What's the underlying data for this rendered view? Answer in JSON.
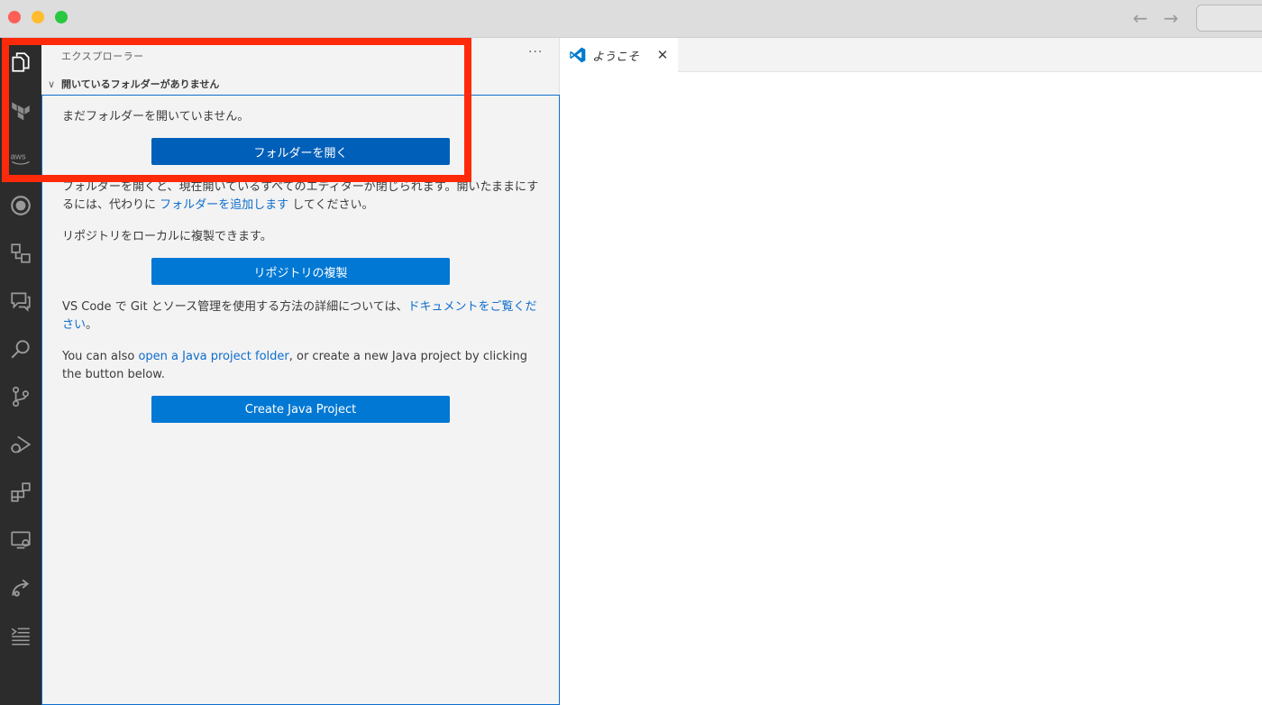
{
  "window": {
    "nav_back_icon": "←",
    "nav_forward_icon": "→"
  },
  "activity_bar": {
    "items": [
      {
        "name": "explorer-icon"
      },
      {
        "name": "terraform-icon"
      },
      {
        "name": "aws-icon",
        "label": "aws"
      },
      {
        "name": "timeline-icon"
      },
      {
        "name": "remote-explorer-icon"
      },
      {
        "name": "comments-icon"
      },
      {
        "name": "search-icon"
      },
      {
        "name": "source-control-icon"
      },
      {
        "name": "run-debug-icon"
      },
      {
        "name": "extensions-icon"
      },
      {
        "name": "remote-window-icon"
      },
      {
        "name": "live-share-icon"
      },
      {
        "name": "outline-icon"
      }
    ]
  },
  "sidebar": {
    "title": "エクスプローラー",
    "more_icon": "···",
    "section": {
      "chevron": "∨",
      "label": "開いているフォルダーがありません"
    },
    "no_folder_text": "まだフォルダーを開いていません。",
    "open_folder_button": "フォルダーを開く",
    "workspace_text_before": "フォルダーを開くと、現在開いているすべてのエディターが閉じられます。開いたままにするには、代わりに ",
    "workspace_link": "フォルダーを追加します",
    "workspace_text_after": " してください。",
    "clone_text": "リポジトリをローカルに複製できます。",
    "clone_button": "リポジトリの複製",
    "git_text_before": "VS Code で Git とソース管理を使用する方法の詳細については、",
    "git_link": "ドキュメントをご覧ください",
    "git_text_after": "。",
    "java_text_before": "You can also ",
    "java_link": "open a Java project folder",
    "java_text_after": ", or create a new Java project by clicking the button below.",
    "java_button": "Create Java Project"
  },
  "editor": {
    "tab_label": "ようこそ",
    "tab_close_icon": "✕"
  },
  "colors": {
    "accent": "#0078d4",
    "highlight": "#ff2a0a",
    "activity_bg": "#2c2c2c"
  }
}
